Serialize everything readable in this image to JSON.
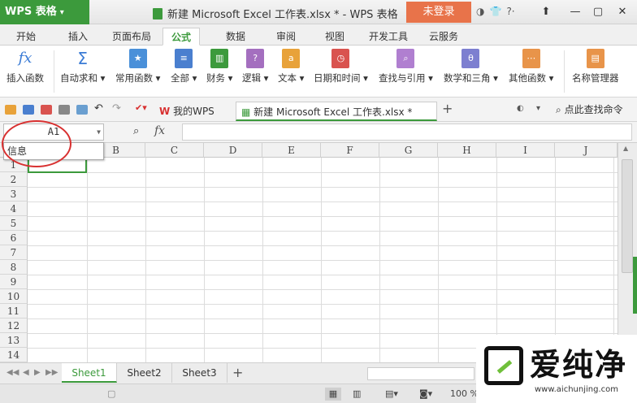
{
  "app": {
    "name": "WPS 表格"
  },
  "window": {
    "title": "新建 Microsoft Excel 工作表.xlsx * - WPS 表格"
  },
  "login_label": "未登录",
  "tabs": [
    "开始",
    "插入",
    "页面布局",
    "公式",
    "数据",
    "审阅",
    "视图",
    "开发工具",
    "云服务"
  ],
  "active_tab": "公式",
  "ribbon": {
    "insert_function": "插入函数",
    "autosum": "自动求和",
    "common_functions": "常用函数",
    "all": "全部",
    "finance": "财务",
    "logic": "逻辑",
    "text": "文本",
    "datetime": "日期和时间",
    "lookup": "查找与引用",
    "math": "数学和三角",
    "other": "其他函数",
    "name_manager": "名称管理器"
  },
  "doc_tabs": {
    "home": "我的WPS",
    "file": "新建 Microsoft Excel 工作表.xlsx *"
  },
  "search_label": "点此查找命令",
  "namebox": {
    "value": "A1",
    "popup": "信息"
  },
  "formula": {
    "fx": "fx",
    "value": ""
  },
  "columns": [
    "B",
    "C",
    "D",
    "E",
    "F",
    "G",
    "H",
    "I",
    "J"
  ],
  "rows": [
    "1",
    "2",
    "3",
    "4",
    "5",
    "6",
    "7",
    "8",
    "9",
    "10",
    "11",
    "12",
    "13",
    "14"
  ],
  "sheets": [
    "Sheet1",
    "Sheet2",
    "Sheet3"
  ],
  "active_sheet": "Sheet1",
  "status": {
    "zoom": "100 %"
  },
  "watermark": {
    "brand": "爱纯净",
    "url": "www.aichunjing.com"
  },
  "colors": {
    "accent": "#3c9a3c",
    "login": "#e8734a",
    "annotation": "#d83030"
  }
}
